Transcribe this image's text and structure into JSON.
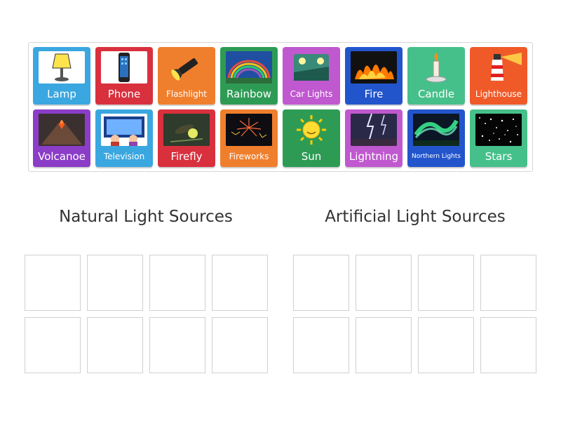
{
  "cards": [
    {
      "label": "Lamp",
      "color": "#3aa7e0",
      "icon": "lamp-icon"
    },
    {
      "label": "Phone",
      "color": "#d9303e",
      "icon": "phone-icon"
    },
    {
      "label": "Flashlight",
      "color": "#f07f2d",
      "icon": "flashlight-icon"
    },
    {
      "label": "Rainbow",
      "color": "#2e9b55",
      "icon": "rainbow-icon"
    },
    {
      "label": "Car Lights",
      "color": "#c058cf",
      "icon": "car-lights-icon"
    },
    {
      "label": "Fire",
      "color": "#2255cc",
      "icon": "fire-icon"
    },
    {
      "label": "Candle",
      "color": "#46c08a",
      "icon": "candle-icon"
    },
    {
      "label": "Lighthouse",
      "color": "#f05a28",
      "icon": "lighthouse-icon"
    },
    {
      "label": "Volcanoe",
      "color": "#8b3dc7",
      "icon": "volcano-icon"
    },
    {
      "label": "Television",
      "color": "#3aa7e0",
      "icon": "television-icon"
    },
    {
      "label": "Firefly",
      "color": "#d9303e",
      "icon": "firefly-icon"
    },
    {
      "label": "Fireworks",
      "color": "#f07f2d",
      "icon": "fireworks-icon"
    },
    {
      "label": "Sun",
      "color": "#2e9b55",
      "icon": "sun-icon"
    },
    {
      "label": "Lightning",
      "color": "#c058cf",
      "icon": "lightning-icon"
    },
    {
      "label": "Northern Lights",
      "color": "#2255cc",
      "icon": "northern-lights-icon"
    },
    {
      "label": "Stars",
      "color": "#46c08a",
      "icon": "stars-icon"
    }
  ],
  "groups": {
    "natural": {
      "title": "Natural Light Sources"
    },
    "artificial": {
      "title": "Artificial Light Sources"
    }
  }
}
